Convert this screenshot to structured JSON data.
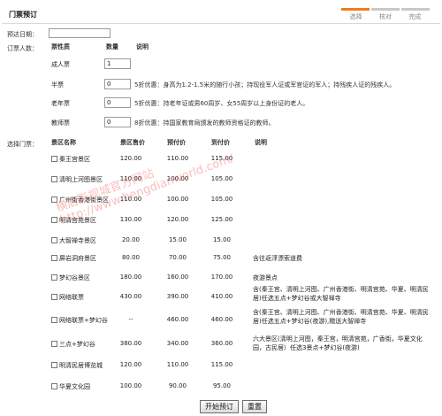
{
  "header": {
    "title": "门票预订",
    "steps": [
      {
        "label": "选择",
        "active": true
      },
      {
        "label": "核对",
        "active": false
      },
      {
        "label": "完成",
        "active": false
      }
    ]
  },
  "arrival": {
    "label": "预达日期：",
    "value": ""
  },
  "tickets": {
    "section_label": "订票人数：",
    "headers": {
      "type": "票性质",
      "qty": "数量",
      "desc": "说明"
    },
    "rows": [
      {
        "name": "成人票",
        "qty": "1",
        "desc": ""
      },
      {
        "name": "半票",
        "qty": "0",
        "desc": "5折优惠：身高为1.2-1.5米的随行小孩；持现役军人证或军官证的军人；持残疾人证的残疾人。"
      },
      {
        "name": "老年票",
        "qty": "0",
        "desc": "5折优惠：持老年证或男60周岁、女55周岁以上身份证的老人。"
      },
      {
        "name": "教师票",
        "qty": "0",
        "desc": "8折优惠：持国家教育局颁发的教师资格证的教师。"
      }
    ]
  },
  "spots": {
    "section_label": "选择门票：",
    "headers": {
      "name": "景区名称",
      "price": "景区售价",
      "booking": "预付价",
      "arrival": "到付价",
      "desc": "说明"
    },
    "rows": [
      {
        "name": "秦王宫景区",
        "price": "120.00",
        "booking": "110.00",
        "arrival": "115.00",
        "desc": ""
      },
      {
        "name": "清明上河图景区",
        "price": "110.00",
        "booking": "100.00",
        "arrival": "105.00",
        "desc": ""
      },
      {
        "name": "广州街香港街景区",
        "price": "110.00",
        "booking": "100.00",
        "arrival": "105.00",
        "desc": ""
      },
      {
        "name": "明清宫苑景区",
        "price": "130.00",
        "booking": "120.00",
        "arrival": "125.00",
        "desc": ""
      },
      {
        "name": "大智禅寺景区",
        "price": "20.00",
        "booking": "15.00",
        "arrival": "15.00",
        "desc": ""
      },
      {
        "name": "屏岩洞府景区",
        "price": "80.00",
        "booking": "70.00",
        "arrival": "75.00",
        "desc": "含往返浮漂索道费"
      },
      {
        "name": "梦幻谷景区",
        "price": "180.00",
        "booking": "160.00",
        "arrival": "170.00",
        "desc": "夜游景点"
      },
      {
        "name": "网络联票",
        "price": "430.00",
        "booking": "390.00",
        "arrival": "410.00",
        "desc": "含(秦王宫、清明上河图、广州香港街、明清宫苑、华夏、明清民居)任选五点+梦幻谷或大智禅寺"
      },
      {
        "name": "网络联票+梦幻谷",
        "price": "--",
        "booking": "460.00",
        "arrival": "460.00",
        "desc": "含(秦王宫、清明上河图、广州香港街、明清宫苑、华夏、明清民居)任选五点+梦幻谷(夜游),赠送大智禅寺"
      },
      {
        "name": "三点+梦幻谷",
        "price": "380.00",
        "booking": "340.00",
        "arrival": "360.00",
        "desc": "六大景区(清明上河图，秦王宫，明清宫苑，广香街，华夏文化园，古民居）任选3景点+梦幻谷(夜游)"
      },
      {
        "name": "明清民居博览城",
        "price": "120.00",
        "booking": "110.00",
        "arrival": "115.00",
        "desc": ""
      },
      {
        "name": "华夏文化园",
        "price": "100.00",
        "booking": "90.00",
        "arrival": "95.00",
        "desc": ""
      }
    ]
  },
  "buttons": {
    "submit": "开始预订",
    "reset": "重置"
  },
  "watermark": {
    "line1": "横店影视城官方网站",
    "line2": "http://www.hengdianworld.com/"
  },
  "colors": {
    "step_active": "#f07b1d",
    "step_inactive": "#c8c8c8",
    "watermark": "#e44444"
  }
}
